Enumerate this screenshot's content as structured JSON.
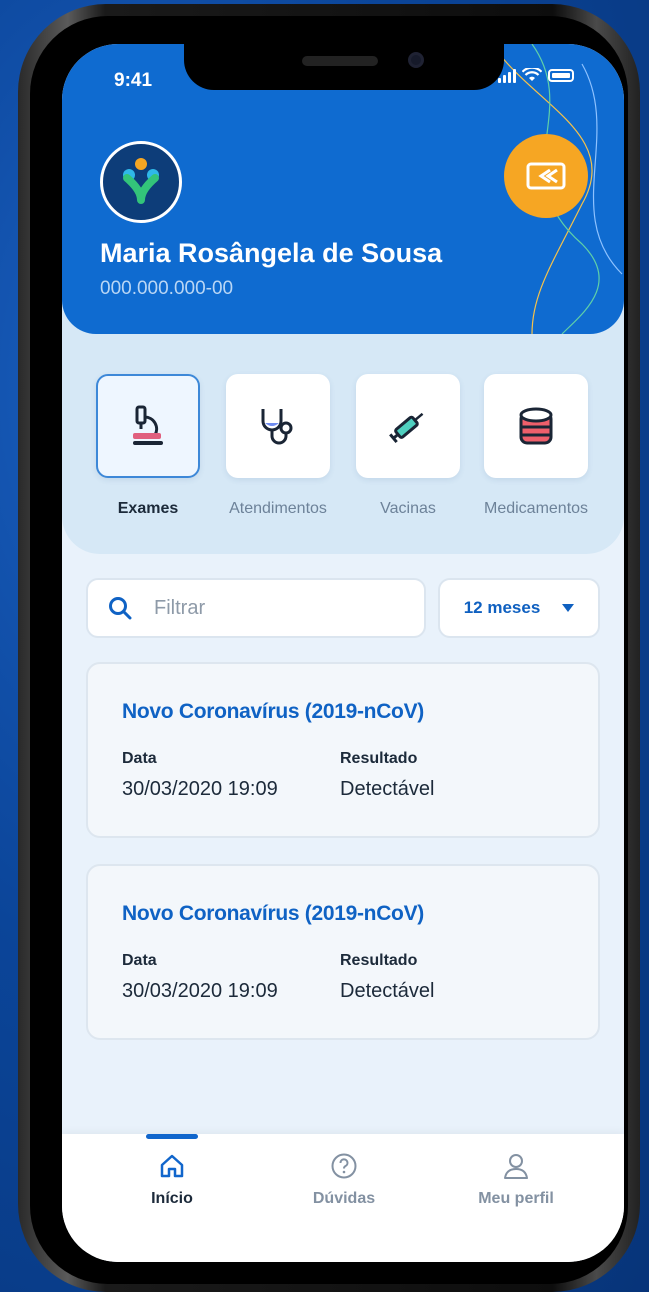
{
  "status_bar": {
    "time": "9:41"
  },
  "user": {
    "name": "Maria Rosângela de Sousa",
    "cpf": "000.000.000-00"
  },
  "categories": [
    {
      "label": "Exames",
      "icon": "microscope-icon",
      "active": true
    },
    {
      "label": "Atendimentos",
      "icon": "stethoscope-icon",
      "active": false
    },
    {
      "label": "Vacinas",
      "icon": "syringe-icon",
      "active": false
    },
    {
      "label": "Medicamentos",
      "icon": "pill-bottle-icon",
      "active": false
    }
  ],
  "filter": {
    "placeholder": "Filtrar",
    "period": "12 meses"
  },
  "results": [
    {
      "title": "Novo Coronavírus (2019-nCoV)",
      "date_label": "Data",
      "date_value": "30/03/2020 19:09",
      "result_label": "Resultado",
      "result_value": "Detectável"
    },
    {
      "title": "Novo Coronavírus (2019-nCoV)",
      "date_label": "Data",
      "date_value": "30/03/2020 19:09",
      "result_label": "Resultado",
      "result_value": "Detectável"
    }
  ],
  "nav": [
    {
      "label": "Início",
      "icon": "home-icon",
      "active": true
    },
    {
      "label": "Dúvidas",
      "icon": "help-circle-icon",
      "active": false
    },
    {
      "label": "Meu perfil",
      "icon": "user-icon",
      "active": false
    }
  ],
  "colors": {
    "primary": "#0f6bd0",
    "accent": "#f6a623",
    "title_blue": "#0f62c4"
  }
}
